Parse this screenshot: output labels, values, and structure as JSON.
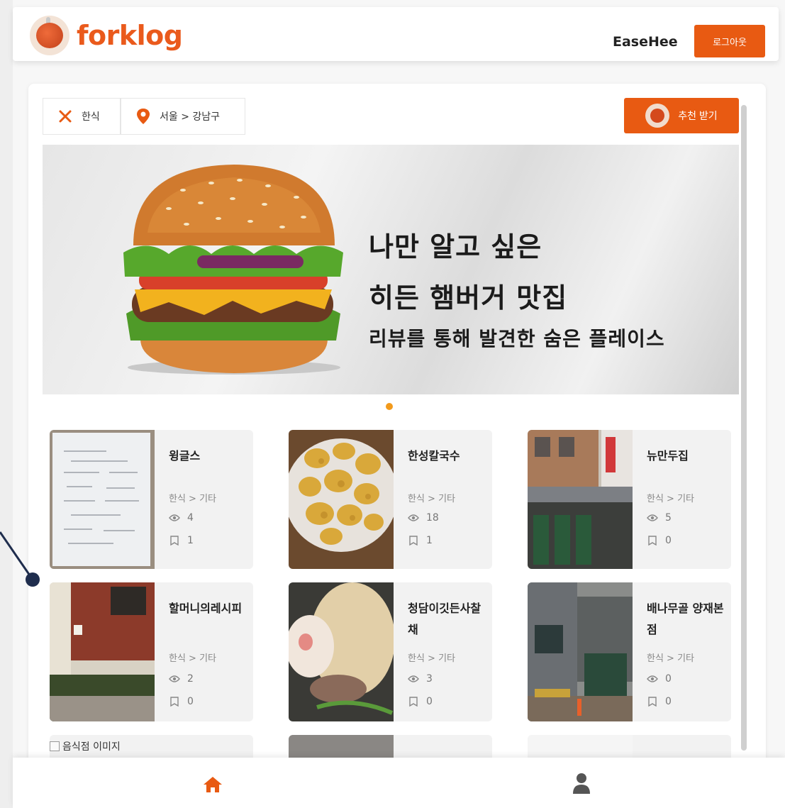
{
  "header": {
    "logo_text": "forklog",
    "user_name": "EaseHee",
    "logout_label": "로그아웃"
  },
  "filters": {
    "food_category": "한식",
    "location": "서울 > 강남구"
  },
  "recommend_button_label": "추천 받기",
  "banner": {
    "line1": "나만 알고 싶은",
    "line2": "히든 햄버거 맛집",
    "line3": "리뷰를 통해 발견한 숨은 플레이스"
  },
  "restaurants": [
    {
      "name": "윙글스",
      "category": "한식 > 기타",
      "views": "4",
      "bookmarks": "1"
    },
    {
      "name": "한성칼국수",
      "category": "한식 > 기타",
      "views": "18",
      "bookmarks": "1"
    },
    {
      "name": "뉴만두집",
      "category": "한식 > 기타",
      "views": "5",
      "bookmarks": "0"
    },
    {
      "name": "할머니의레시피",
      "category": "한식 > 기타",
      "views": "2",
      "bookmarks": "0"
    },
    {
      "name": "청담이깃든사찰채",
      "category": "한식 > 기타",
      "views": "3",
      "bookmarks": "0"
    },
    {
      "name": "배나무골 양재본점",
      "category": "한식 > 기타",
      "views": "0",
      "bookmarks": "0"
    }
  ],
  "partial_row": {
    "image_alt": "음식점 이미지"
  },
  "icons": {
    "food": "fork-knife-icon",
    "location": "map-pin-icon",
    "views": "eye-icon",
    "bookmarks": "bookmark-icon",
    "home": "home-icon",
    "user": "user-icon"
  },
  "colors": {
    "brand": "#e85a12",
    "dot": "#f29a1c"
  }
}
